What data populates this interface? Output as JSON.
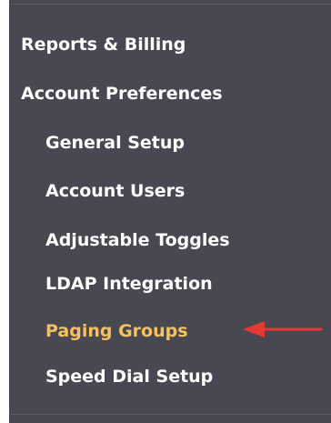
{
  "menu": {
    "items": [
      {
        "label": "Reports & Billing",
        "level": 1,
        "active": false
      },
      {
        "label": "Account Preferences",
        "level": 1,
        "active": false
      },
      {
        "label": "General Setup",
        "level": 2,
        "active": false
      },
      {
        "label": "Account Users",
        "level": 2,
        "active": false
      },
      {
        "label": "Adjustable Toggles",
        "level": 2,
        "active": false
      },
      {
        "label": "LDAP Integration",
        "level": 2,
        "active": false
      },
      {
        "label": "Paging Groups",
        "level": 2,
        "active": true
      },
      {
        "label": "Speed Dial Setup",
        "level": 2,
        "active": false
      }
    ]
  },
  "annotation": {
    "arrow_icon": "arrow-left-icon",
    "arrow_color": "#e53a2f"
  },
  "colors": {
    "panel_bg": "#484853",
    "text": "#ffffff",
    "active_text": "#f7c15f"
  }
}
